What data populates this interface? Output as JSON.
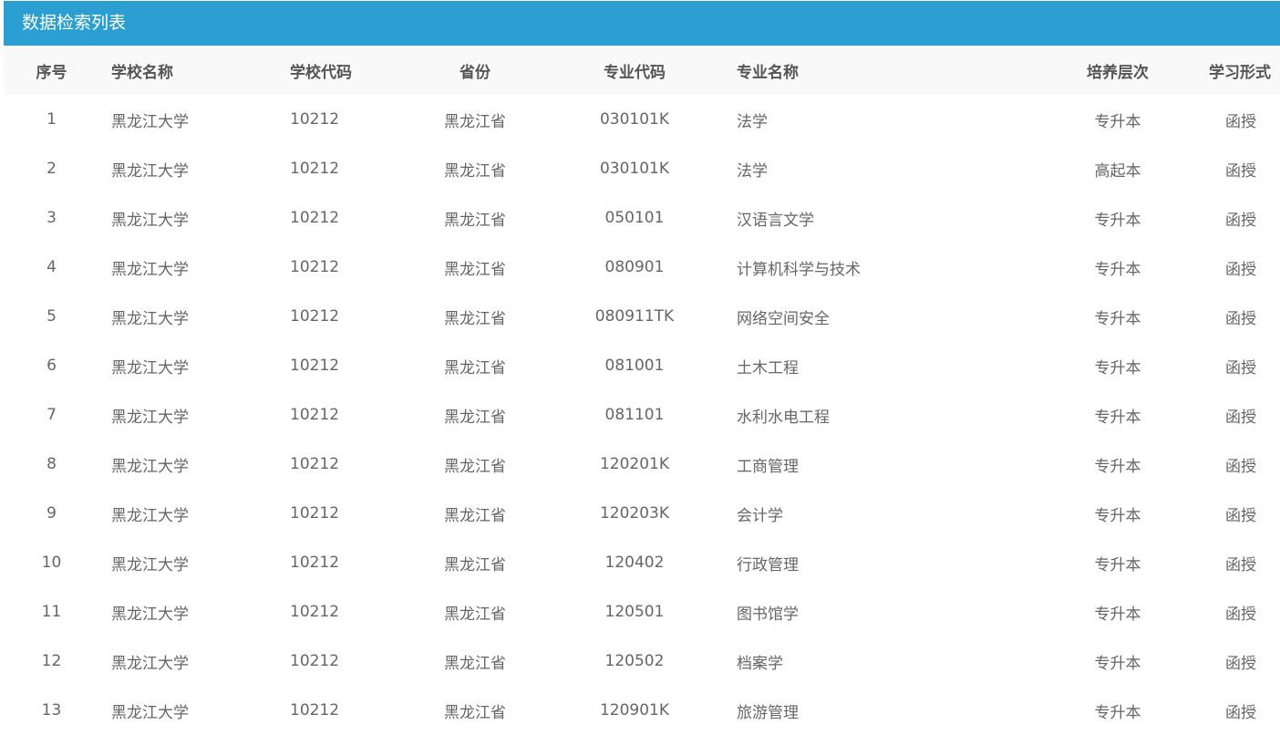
{
  "panel": {
    "title": "数据检索列表"
  },
  "table": {
    "columns": [
      "序号",
      "学校名称",
      "学校代码",
      "省份",
      "专业代码",
      "专业名称",
      "培养层次",
      "学习形式"
    ],
    "rows": [
      [
        "1",
        "黑龙江大学",
        "10212",
        "黑龙江省",
        "030101K",
        "法学",
        "专升本",
        "函授"
      ],
      [
        "2",
        "黑龙江大学",
        "10212",
        "黑龙江省",
        "030101K",
        "法学",
        "高起本",
        "函授"
      ],
      [
        "3",
        "黑龙江大学",
        "10212",
        "黑龙江省",
        "050101",
        "汉语言文学",
        "专升本",
        "函授"
      ],
      [
        "4",
        "黑龙江大学",
        "10212",
        "黑龙江省",
        "080901",
        "计算机科学与技术",
        "专升本",
        "函授"
      ],
      [
        "5",
        "黑龙江大学",
        "10212",
        "黑龙江省",
        "080911TK",
        "网络空间安全",
        "专升本",
        "函授"
      ],
      [
        "6",
        "黑龙江大学",
        "10212",
        "黑龙江省",
        "081001",
        "土木工程",
        "专升本",
        "函授"
      ],
      [
        "7",
        "黑龙江大学",
        "10212",
        "黑龙江省",
        "081101",
        "水利水电工程",
        "专升本",
        "函授"
      ],
      [
        "8",
        "黑龙江大学",
        "10212",
        "黑龙江省",
        "120201K",
        "工商管理",
        "专升本",
        "函授"
      ],
      [
        "9",
        "黑龙江大学",
        "10212",
        "黑龙江省",
        "120203K",
        "会计学",
        "专升本",
        "函授"
      ],
      [
        "10",
        "黑龙江大学",
        "10212",
        "黑龙江省",
        "120402",
        "行政管理",
        "专升本",
        "函授"
      ],
      [
        "11",
        "黑龙江大学",
        "10212",
        "黑龙江省",
        "120501",
        "图书馆学",
        "专升本",
        "函授"
      ],
      [
        "12",
        "黑龙江大学",
        "10212",
        "黑龙江省",
        "120502",
        "档案学",
        "专升本",
        "函授"
      ],
      [
        "13",
        "黑龙江大学",
        "10212",
        "黑龙江省",
        "120901K",
        "旅游管理",
        "专升本",
        "函授"
      ]
    ]
  },
  "colors": {
    "header_bar": "#2b9fd1",
    "table_head_bg": "#f9f9f9",
    "text": "#666666"
  }
}
